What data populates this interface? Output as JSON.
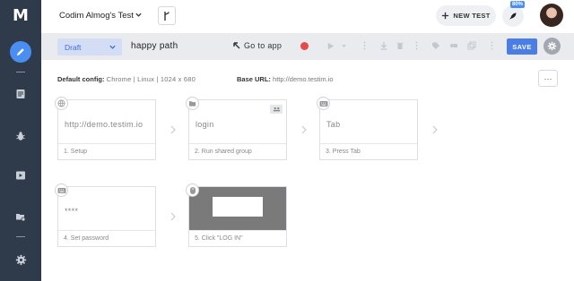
{
  "app": {
    "logo": "M"
  },
  "header": {
    "project_name": "Codim Almog's Test",
    "new_test_label": "NEW TEST",
    "badge_percent": "80%"
  },
  "toolbar": {
    "status": "Draft",
    "test_name": "happy path",
    "goto_app_label": "Go to app",
    "save_label": "SAVE"
  },
  "config": {
    "default_config_label": "Default config:",
    "default_config_value": "Chrome | Linux | 1024 x 680",
    "base_url_label": "Base URL:",
    "base_url_value": "http://demo.testim.io",
    "more_label": "···"
  },
  "steps": [
    {
      "text": "http://demo.testim.io",
      "label": "1. Setup",
      "icon": "globe-icon"
    },
    {
      "text": "login",
      "label": "2. Run shared group",
      "icon": "folder-icon"
    },
    {
      "text": "Tab",
      "label": "3. Press Tab",
      "icon": "keyboard-icon"
    },
    {
      "text": "****",
      "label": "4. Set password",
      "icon": "keyboard-icon"
    },
    {
      "text": "",
      "label": "5. Click \"LOG IN\"",
      "icon": "mouse-icon"
    }
  ],
  "sidebar": {
    "items": [
      "edit-icon",
      "list-icon",
      "bug-icon",
      "play-icon",
      "folder-settings-icon",
      "gear-icon"
    ]
  },
  "colors": {
    "sidebar": "#2f3a4b",
    "accent": "#4b7de6",
    "toolbar": "#e9ebef",
    "record": "#e44b4b"
  }
}
